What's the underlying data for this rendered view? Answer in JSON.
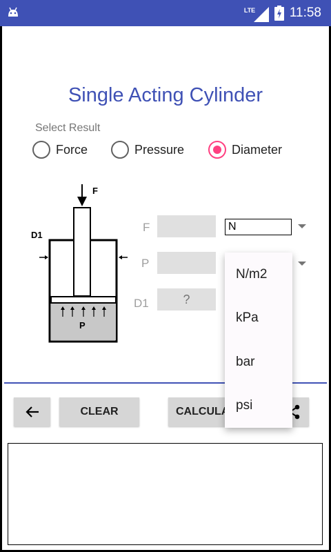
{
  "status_bar": {
    "network": "LTE",
    "time": "11:58",
    "icons": [
      "android-debug-icon",
      "signal-icon",
      "battery-charging-icon"
    ]
  },
  "app": {
    "title": "Single Acting Cylinder",
    "select_result_label": "Select Result",
    "result_options": [
      {
        "label": "Force",
        "checked": false
      },
      {
        "label": "Pressure",
        "checked": false
      },
      {
        "label": "Diameter",
        "checked": true
      }
    ],
    "diagram_labels": {
      "force": "F",
      "diameter": "D1",
      "pressure": "P"
    },
    "fields": {
      "force": {
        "label": "F",
        "value": "",
        "unit": "N"
      },
      "pressure": {
        "label": "P",
        "value": ""
      },
      "diameter": {
        "label": "D1",
        "placeholder": "?"
      }
    },
    "unit_dropdown_options": [
      "N/m2",
      "kPa",
      "bar",
      "psi"
    ],
    "buttons": {
      "back": "back-arrow-icon",
      "clear": "CLEAR",
      "calculate": "CALCULATE",
      "share": "share-icon"
    },
    "result_text": ""
  },
  "colors": {
    "primary": "#3f51b5",
    "accent": "#ff4081",
    "field_bg": "#e0e0e0",
    "button_bg": "#d6d6d6"
  }
}
